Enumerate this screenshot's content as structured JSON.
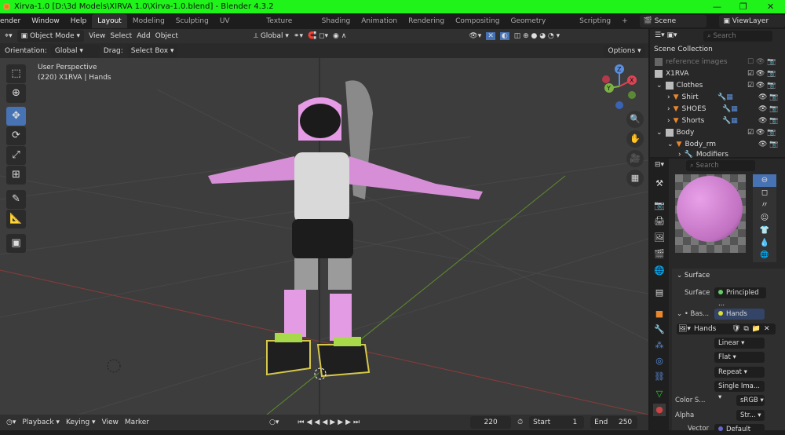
{
  "window": {
    "title": "Xirva-1.0 [D:\\3d Models\\XIRVA 1.0\\Xirva-1.0.blend] - Blender 4.3.2",
    "minimize": "—",
    "maximize": "❐",
    "close": "✕"
  },
  "menu": [
    "ender",
    "Window",
    "Help"
  ],
  "workspaces": [
    "Layout",
    "Modeling",
    "Sculpting",
    "UV Editing",
    "Texture Paint",
    "Shading",
    "Animation",
    "Rendering",
    "Compositing",
    "Geometry Nodes",
    "Scripting"
  ],
  "add_workspace": "+",
  "scene": "Scene",
  "view_layer": "ViewLayer",
  "viewport_header": {
    "mode": "Object Mode",
    "menus": [
      "View",
      "Select",
      "Add",
      "Object"
    ],
    "transform": "Global"
  },
  "tool_header": {
    "orientation_label": "Orientation:",
    "orientation": "Global",
    "drag_label": "Drag:",
    "drag": "Select Box",
    "options": "Options"
  },
  "overlay": {
    "view": "User Perspective",
    "object": "(220) X1RVA | Hands"
  },
  "gizmo": {
    "x": "X",
    "y": "Y",
    "z": "Z"
  },
  "outliner": {
    "search_placeholder": "Search",
    "title": "Scene Collection",
    "items": [
      {
        "name": "reference images",
        "type": "collection"
      },
      {
        "name": "X1RVA",
        "type": "collection"
      },
      {
        "name": "Clothes",
        "type": "collection"
      },
      {
        "name": "Shirt",
        "type": "mesh"
      },
      {
        "name": "SHOES",
        "type": "mesh"
      },
      {
        "name": "Shorts",
        "type": "mesh"
      },
      {
        "name": "Body",
        "type": "collection"
      },
      {
        "name": "Body_rm",
        "type": "mesh"
      },
      {
        "name": "Modifiers",
        "type": "modifier"
      }
    ]
  },
  "properties": {
    "search_placeholder": "Search",
    "surface_panel": "Surface",
    "surface_label": "Surface",
    "surface_value": "Principled ...",
    "base_label": "Bas...",
    "base_value": "Hands",
    "image_name": "Hands",
    "interpolation": "Linear",
    "projection": "Flat",
    "extension": "Repeat",
    "source": "Single Ima...",
    "colorspace_label": "Color S...",
    "colorspace": "sRGB",
    "alpha_label": "Alpha",
    "alpha": "Str...",
    "vector_label": "Vector",
    "vector": "Default",
    "preview_color": "#e08de0"
  },
  "timeline": {
    "menus": [
      "Playback",
      "Keying",
      "View",
      "Marker"
    ],
    "frame": "220",
    "start_label": "Start",
    "start": "1",
    "end_label": "End",
    "end": "250"
  }
}
